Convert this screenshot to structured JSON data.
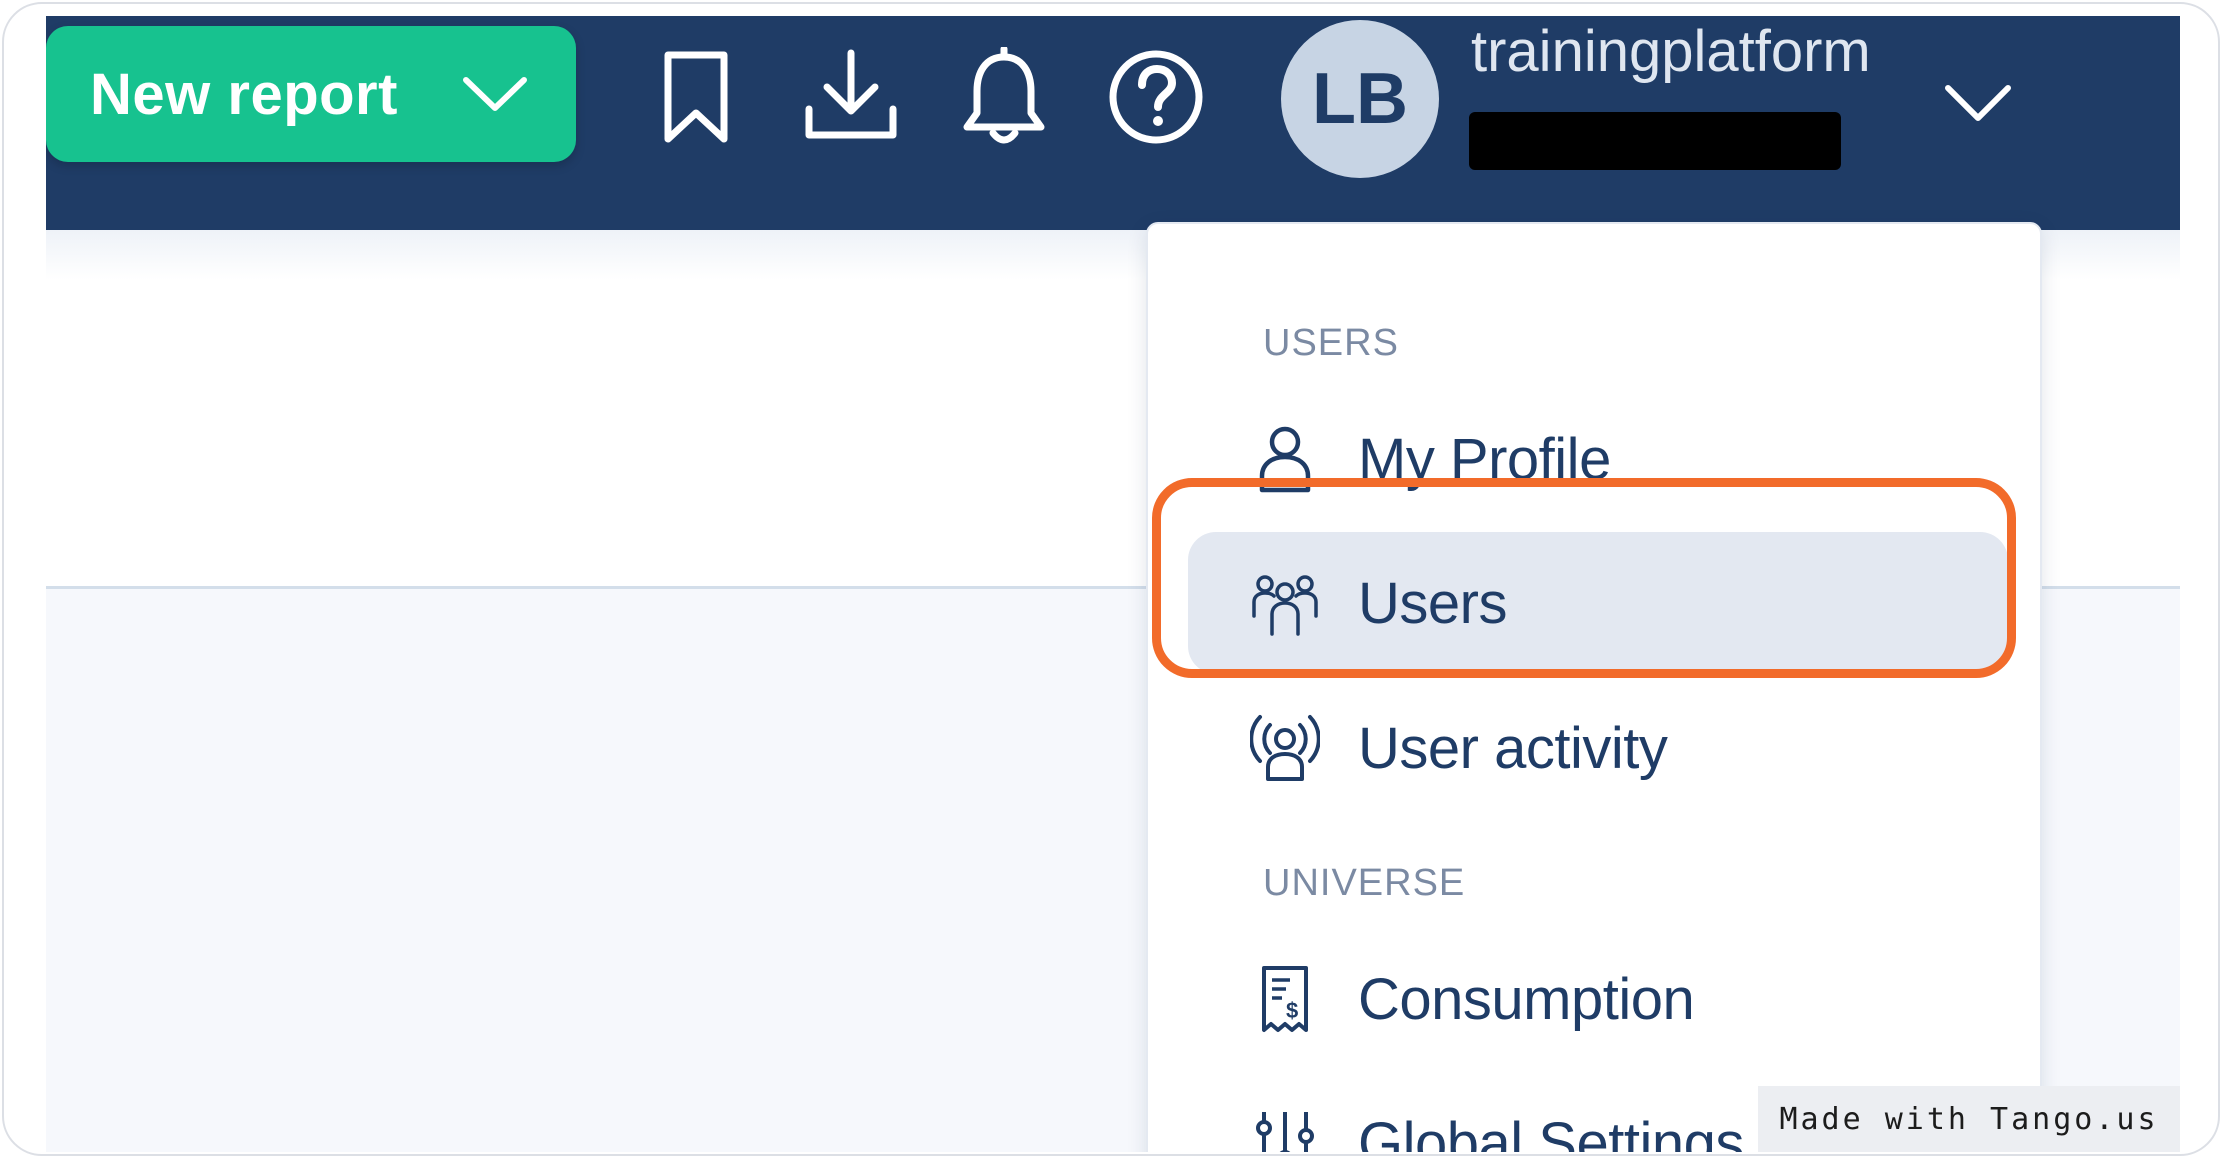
{
  "topbar": {
    "new_report_label": "New report",
    "icons": [
      "bookmark-icon",
      "download-icon",
      "bell-icon",
      "help-icon"
    ],
    "avatar_initials": "LB",
    "account_name": "trainingplatform",
    "colors": {
      "topbar_bg": "#1f3c66",
      "new_report_bg": "#17c28f",
      "avatar_bg": "#c7d4e4"
    }
  },
  "dropdown": {
    "sections": [
      {
        "label": "USERS",
        "items": [
          {
            "label": "My Profile",
            "icon": "user-icon"
          },
          {
            "label": "Users",
            "icon": "users-group-icon",
            "active": true
          },
          {
            "label": "User activity",
            "icon": "user-activity-icon"
          }
        ]
      },
      {
        "label": "UNIVERSE",
        "items": [
          {
            "label": "Consumption",
            "icon": "receipt-icon"
          },
          {
            "label": "Global Settings",
            "icon": "sliders-icon"
          }
        ]
      }
    ],
    "highlight_color": "#f26b2a"
  },
  "watermark": "Made with Tango.us"
}
